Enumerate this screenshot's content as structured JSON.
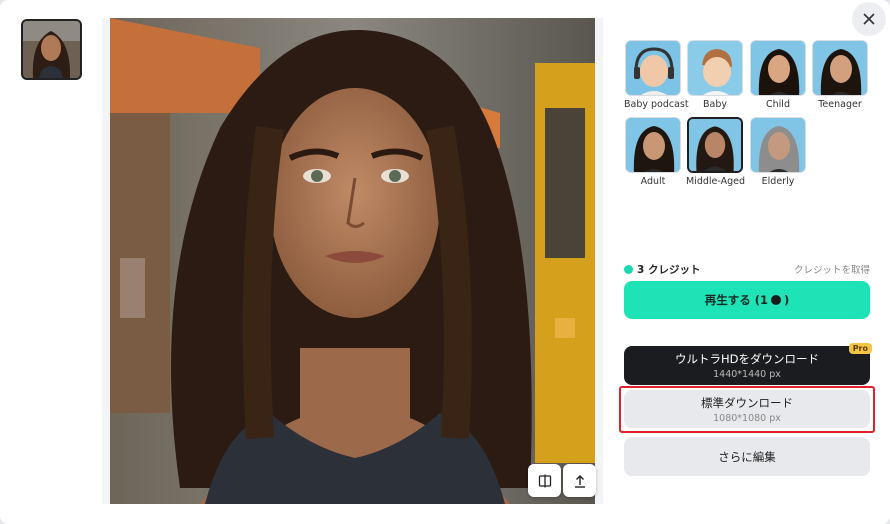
{
  "close": {
    "icon": "close-icon"
  },
  "thumbnail": {
    "alt": "original photo thumbnail"
  },
  "preview": {
    "compare_icon": "compare-icon",
    "share_icon": "upload-icon"
  },
  "age_styles": [
    {
      "label": "Baby podcast",
      "selected": false
    },
    {
      "label": "Baby",
      "selected": false
    },
    {
      "label": "Child",
      "selected": false
    },
    {
      "label": "Teenager",
      "selected": false
    },
    {
      "label": "Adult",
      "selected": false
    },
    {
      "label": "Middle-Aged",
      "selected": true
    },
    {
      "label": "Elderly",
      "selected": false
    }
  ],
  "credits": {
    "count_label": "3 クレジット",
    "get_link": "クレジットを取得"
  },
  "buttons": {
    "regenerate": {
      "label": "再生する (1",
      "close": ")"
    },
    "ultra_hd": {
      "label": "ウルトラHDをダウンロード",
      "size": "1440*1440 px",
      "badge": "Pro"
    },
    "standard": {
      "label": "標準ダウンロード",
      "size": "1080*1080 px"
    },
    "edit_more": {
      "label": "さらに編集"
    }
  },
  "colors": {
    "accent": "#1ee3b7",
    "dark_button": "#1b1c1f",
    "highlight_border": "#e0212b",
    "pro_badge": "#f4c542"
  }
}
